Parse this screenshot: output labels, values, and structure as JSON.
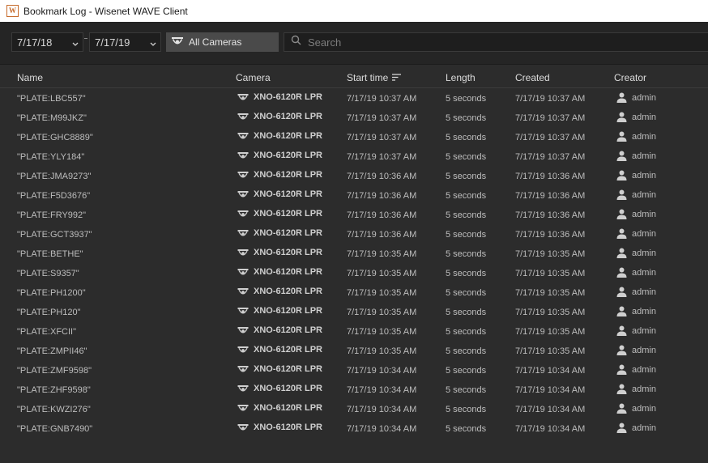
{
  "window": {
    "title": "Bookmark Log - Wisenet WAVE Client",
    "app_icon_letter": "W"
  },
  "filters": {
    "date_from": "7/17/18",
    "date_to": "7/17/19",
    "camera_button": "All Cameras",
    "search_placeholder": "Search"
  },
  "columns": {
    "name": "Name",
    "camera": "Camera",
    "start_time": "Start time",
    "length": "Length",
    "created": "Created",
    "creator": "Creator"
  },
  "rows": [
    {
      "name": "\"PLATE:LBC557\"",
      "camera": "XNO-6120R LPR",
      "start": "7/17/19 10:37 AM",
      "length": "5 seconds",
      "created": "7/17/19 10:37 AM",
      "creator": "admin"
    },
    {
      "name": "\"PLATE:M99JKZ\"",
      "camera": "XNO-6120R LPR",
      "start": "7/17/19 10:37 AM",
      "length": "5 seconds",
      "created": "7/17/19 10:37 AM",
      "creator": "admin"
    },
    {
      "name": "\"PLATE:GHC8889\"",
      "camera": "XNO-6120R LPR",
      "start": "7/17/19 10:37 AM",
      "length": "5 seconds",
      "created": "7/17/19 10:37 AM",
      "creator": "admin"
    },
    {
      "name": "\"PLATE:YLY184\"",
      "camera": "XNO-6120R LPR",
      "start": "7/17/19 10:37 AM",
      "length": "5 seconds",
      "created": "7/17/19 10:37 AM",
      "creator": "admin"
    },
    {
      "name": "\"PLATE:JMA9273\"",
      "camera": "XNO-6120R LPR",
      "start": "7/17/19 10:36 AM",
      "length": "5 seconds",
      "created": "7/17/19 10:36 AM",
      "creator": "admin"
    },
    {
      "name": "\"PLATE:F5D3676\"",
      "camera": "XNO-6120R LPR",
      "start": "7/17/19 10:36 AM",
      "length": "5 seconds",
      "created": "7/17/19 10:36 AM",
      "creator": "admin"
    },
    {
      "name": "\"PLATE:FRY992\"",
      "camera": "XNO-6120R LPR",
      "start": "7/17/19 10:36 AM",
      "length": "5 seconds",
      "created": "7/17/19 10:36 AM",
      "creator": "admin"
    },
    {
      "name": "\"PLATE:GCT3937\"",
      "camera": "XNO-6120R LPR",
      "start": "7/17/19 10:36 AM",
      "length": "5 seconds",
      "created": "7/17/19 10:36 AM",
      "creator": "admin"
    },
    {
      "name": "\"PLATE:BETHE\"",
      "camera": "XNO-6120R LPR",
      "start": "7/17/19 10:35 AM",
      "length": "5 seconds",
      "created": "7/17/19 10:35 AM",
      "creator": "admin"
    },
    {
      "name": "\"PLATE:S9357\"",
      "camera": "XNO-6120R LPR",
      "start": "7/17/19 10:35 AM",
      "length": "5 seconds",
      "created": "7/17/19 10:35 AM",
      "creator": "admin"
    },
    {
      "name": "\"PLATE:PH1200\"",
      "camera": "XNO-6120R LPR",
      "start": "7/17/19 10:35 AM",
      "length": "5 seconds",
      "created": "7/17/19 10:35 AM",
      "creator": "admin"
    },
    {
      "name": "\"PLATE:PH120\"",
      "camera": "XNO-6120R LPR",
      "start": "7/17/19 10:35 AM",
      "length": "5 seconds",
      "created": "7/17/19 10:35 AM",
      "creator": "admin"
    },
    {
      "name": "\"PLATE:XFCII\"",
      "camera": "XNO-6120R LPR",
      "start": "7/17/19 10:35 AM",
      "length": "5 seconds",
      "created": "7/17/19 10:35 AM",
      "creator": "admin"
    },
    {
      "name": "\"PLATE:ZMPII46\"",
      "camera": "XNO-6120R LPR",
      "start": "7/17/19 10:35 AM",
      "length": "5 seconds",
      "created": "7/17/19 10:35 AM",
      "creator": "admin"
    },
    {
      "name": "\"PLATE:ZMF9598\"",
      "camera": "XNO-6120R LPR",
      "start": "7/17/19 10:34 AM",
      "length": "5 seconds",
      "created": "7/17/19 10:34 AM",
      "creator": "admin"
    },
    {
      "name": "\"PLATE:ZHF9598\"",
      "camera": "XNO-6120R LPR",
      "start": "7/17/19 10:34 AM",
      "length": "5 seconds",
      "created": "7/17/19 10:34 AM",
      "creator": "admin"
    },
    {
      "name": "\"PLATE:KWZI276\"",
      "camera": "XNO-6120R LPR",
      "start": "7/17/19 10:34 AM",
      "length": "5 seconds",
      "created": "7/17/19 10:34 AM",
      "creator": "admin"
    },
    {
      "name": "\"PLATE:GNB7490\"",
      "camera": "XNO-6120R LPR",
      "start": "7/17/19 10:34 AM",
      "length": "5 seconds",
      "created": "7/17/19 10:34 AM",
      "creator": "admin"
    }
  ]
}
